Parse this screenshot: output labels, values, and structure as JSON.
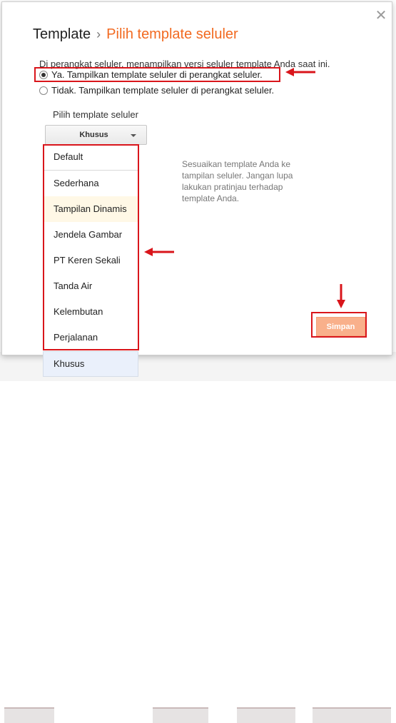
{
  "dialog": {
    "breadcrumb": "Template",
    "separator": "›",
    "title": "Pilih template seluler",
    "description": "Di perangkat seluler, menampilkan versi seluler template Anda saat ini.",
    "options": [
      {
        "label": "Ya. Tampilkan template seluler di perangkat seluler.",
        "checked": true
      },
      {
        "label": "Tidak. Tampilkan template seluler di perangkat seluler.",
        "checked": false
      }
    ],
    "picker_label": "Pilih template seluler",
    "dropdown_value": "Khusus",
    "templates": [
      "Default",
      "Sederhana",
      "Tampilan Dinamis",
      "Jendela Gambar",
      "PT Keren Sekali",
      "Tanda Air",
      "Kelembutan",
      "Perjalanan",
      "Khusus"
    ],
    "hint": "Sesuaikan template Anda ke tampilan seluler. Jangan lupa lakukan pratinjau terhadap template Anda.",
    "save_label": "Simpan",
    "close_icon": "✕"
  },
  "colors": {
    "accent_orange": "#f26a21",
    "highlight_red": "#d9151b",
    "save_button": "#f9b08b"
  }
}
